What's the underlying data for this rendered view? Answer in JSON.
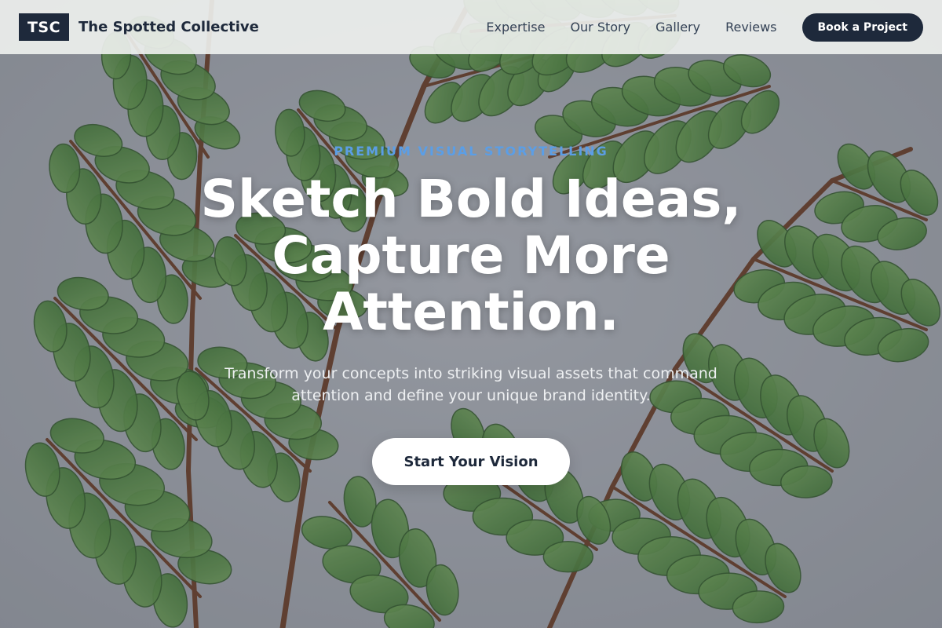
{
  "header": {
    "logo_text": "TSC",
    "brand_name": "The Spotted Collective",
    "nav": [
      {
        "label": "Expertise"
      },
      {
        "label": "Our Story"
      },
      {
        "label": "Gallery"
      },
      {
        "label": "Reviews"
      }
    ],
    "cta_label": "Book a Project"
  },
  "hero": {
    "eyebrow": "PREMIUM VISUAL STORYTELLING",
    "title_lines": [
      "Sketch Bold Ideas,",
      "Capture More",
      "Attention."
    ],
    "subtitle": "Transform your concepts into striking visual assets that command attention and define your unique brand identity.",
    "button_label": "Start Your Vision",
    "background_image": "fern-botanical-illustration"
  },
  "colors": {
    "brand_dark": "#1e293b",
    "accent_blue": "#5b9ee6",
    "leaf_green": "#4f8a3a",
    "stem_brown": "#6b3a1f"
  }
}
